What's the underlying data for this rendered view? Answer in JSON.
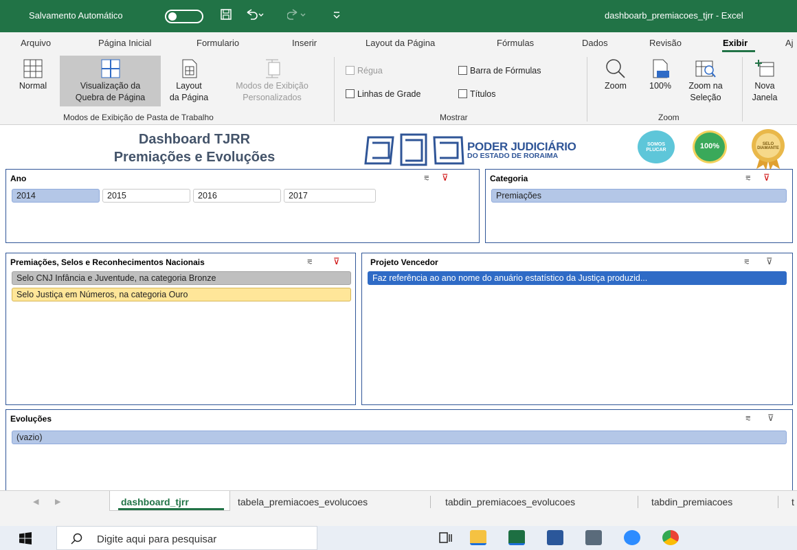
{
  "titlebar": {
    "autosave_label": "Salvamento Automático",
    "filename": "dashboarb_premiacoes_tjrr  -  Excel"
  },
  "menu": [
    "Arquivo",
    "Página Inicial",
    "Formulario",
    "Inserir",
    "Layout da Página",
    "Fórmulas",
    "Dados",
    "Revisão",
    "Exibir",
    "Aj"
  ],
  "menu_active": "Exibir",
  "ribbon": {
    "normal": "Normal",
    "page_break_1": "Visualização da",
    "page_break_2": "Quebra de Página",
    "layout_1": "Layout",
    "layout_2": "da Página",
    "custom_1": "Modos de Exibição",
    "custom_2": "Personalizados",
    "group_views": "Modos de Exibição de Pasta de Trabalho",
    "ruler": "Régua",
    "formula_bar": "Barra de Fórmulas",
    "gridlines": "Linhas de Grade",
    "headings": "Títulos",
    "group_show": "Mostrar",
    "zoom": "Zoom",
    "zoom100": "100%",
    "zoom_sel_1": "Zoom na",
    "zoom_sel_2": "Seleção",
    "group_zoom": "Zoom",
    "new_win_1": "Nova",
    "new_win_2": "Janela"
  },
  "dashboard": {
    "title_1": "Dashboard TJRR",
    "title_2": "Premiações e Evoluções",
    "logo_1": "PODER JUDICIÁRIO",
    "logo_2": "DO ESTADO DE RORAIMA",
    "badge_1": "SOMOS PLUCAR",
    "badge_2": "100%",
    "badge_3": "SELO DIAMANTE"
  },
  "slicers": {
    "ano": {
      "title": "Ano",
      "items": [
        "2014",
        "2015",
        "2016",
        "2017"
      ],
      "selected": "2014"
    },
    "categoria": {
      "title": "Categoria",
      "items": [
        "Premiações"
      ]
    },
    "premiacoes": {
      "title": "Premiações, Selos e Reconhecimentos Nacionais",
      "items": [
        "Selo CNJ Infância e Juventude, na categoria Bronze",
        "Selo Justiça em Números, na categoria Ouro"
      ]
    },
    "projeto": {
      "title": "Projeto Vencedor",
      "items": [
        "Faz referência ao ano nome do anuário estatístico da Justiça produzid..."
      ]
    },
    "evolucoes": {
      "title": "Evoluções",
      "items": [
        "(vazio)"
      ]
    }
  },
  "sheet_tabs": [
    "dashboard_tjrr",
    "tabela_premiacoes_evolucoes",
    "tabdin_premiacoes_evolucoes",
    "tabdin_premiacoes",
    "t"
  ],
  "sheet_tab_active": "dashboard_tjrr",
  "taskbar": {
    "search_placeholder": "Digite aqui para pesquisar"
  },
  "colors": {
    "excel_green": "#217346",
    "slicer_selected": "#b4c7e7",
    "slicer_border": "#2f5597"
  }
}
